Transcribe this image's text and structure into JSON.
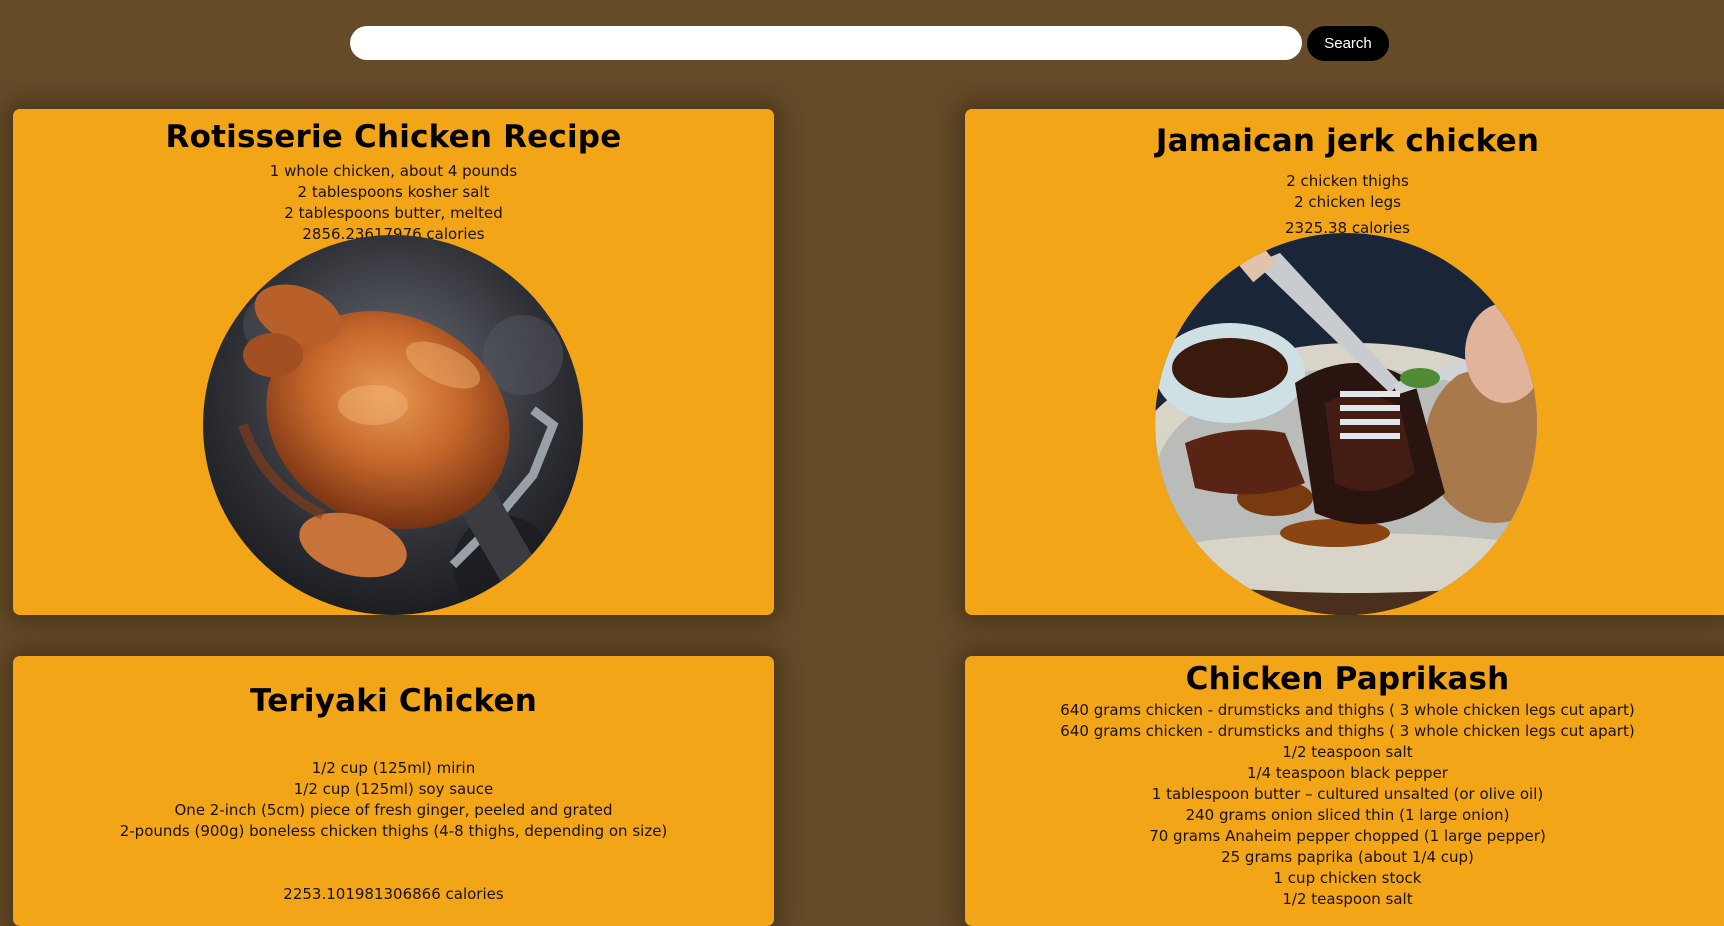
{
  "search": {
    "placeholder": "",
    "value": "",
    "button_label": "Search"
  },
  "recipes": [
    {
      "title": "Rotisserie Chicken Recipe",
      "ingredients": [
        "1 whole chicken, about 4 pounds",
        "2 tablespoons kosher salt",
        "2 tablespoons butter, melted"
      ],
      "calories": "2856.23617976 calories",
      "image": "rotisserie-chicken-photo"
    },
    {
      "title": "Jamaican jerk chicken",
      "ingredients": [
        "2 chicken thighs",
        "2 chicken legs"
      ],
      "calories": "2325.38 calories",
      "image": "jerk-chicken-photo"
    },
    {
      "title": "Teriyaki Chicken",
      "ingredients": [
        "1/2 cup (125ml) mirin",
        "1/2 cup (125ml) soy sauce",
        "One 2-inch (5cm) piece of fresh ginger, peeled and grated",
        "2-pounds (900g) boneless chicken thighs (4-8 thighs, depending on size)"
      ],
      "calories": "2253.101981306866 calories"
    },
    {
      "title": "Chicken Paprikash",
      "ingredients": [
        "640 grams chicken - drumsticks and thighs ( 3 whole chicken legs cut apart)",
        "640 grams chicken - drumsticks and thighs ( 3 whole chicken legs cut apart)",
        "1/2 teaspoon salt",
        "1/4 teaspoon black pepper",
        "1 tablespoon butter – cultured unsalted (or olive oil)",
        "240 grams onion sliced thin (1 large onion)",
        "70 grams Anaheim pepper chopped (1 large pepper)",
        "25 grams paprika (about 1/4 cup)",
        "1 cup chicken stock",
        "1/2 teaspoon salt"
      ]
    }
  ],
  "colors": {
    "page_background": "#654b28",
    "card_background": "#f2a516",
    "button_background": "#000000",
    "button_text": "#ffffff"
  }
}
